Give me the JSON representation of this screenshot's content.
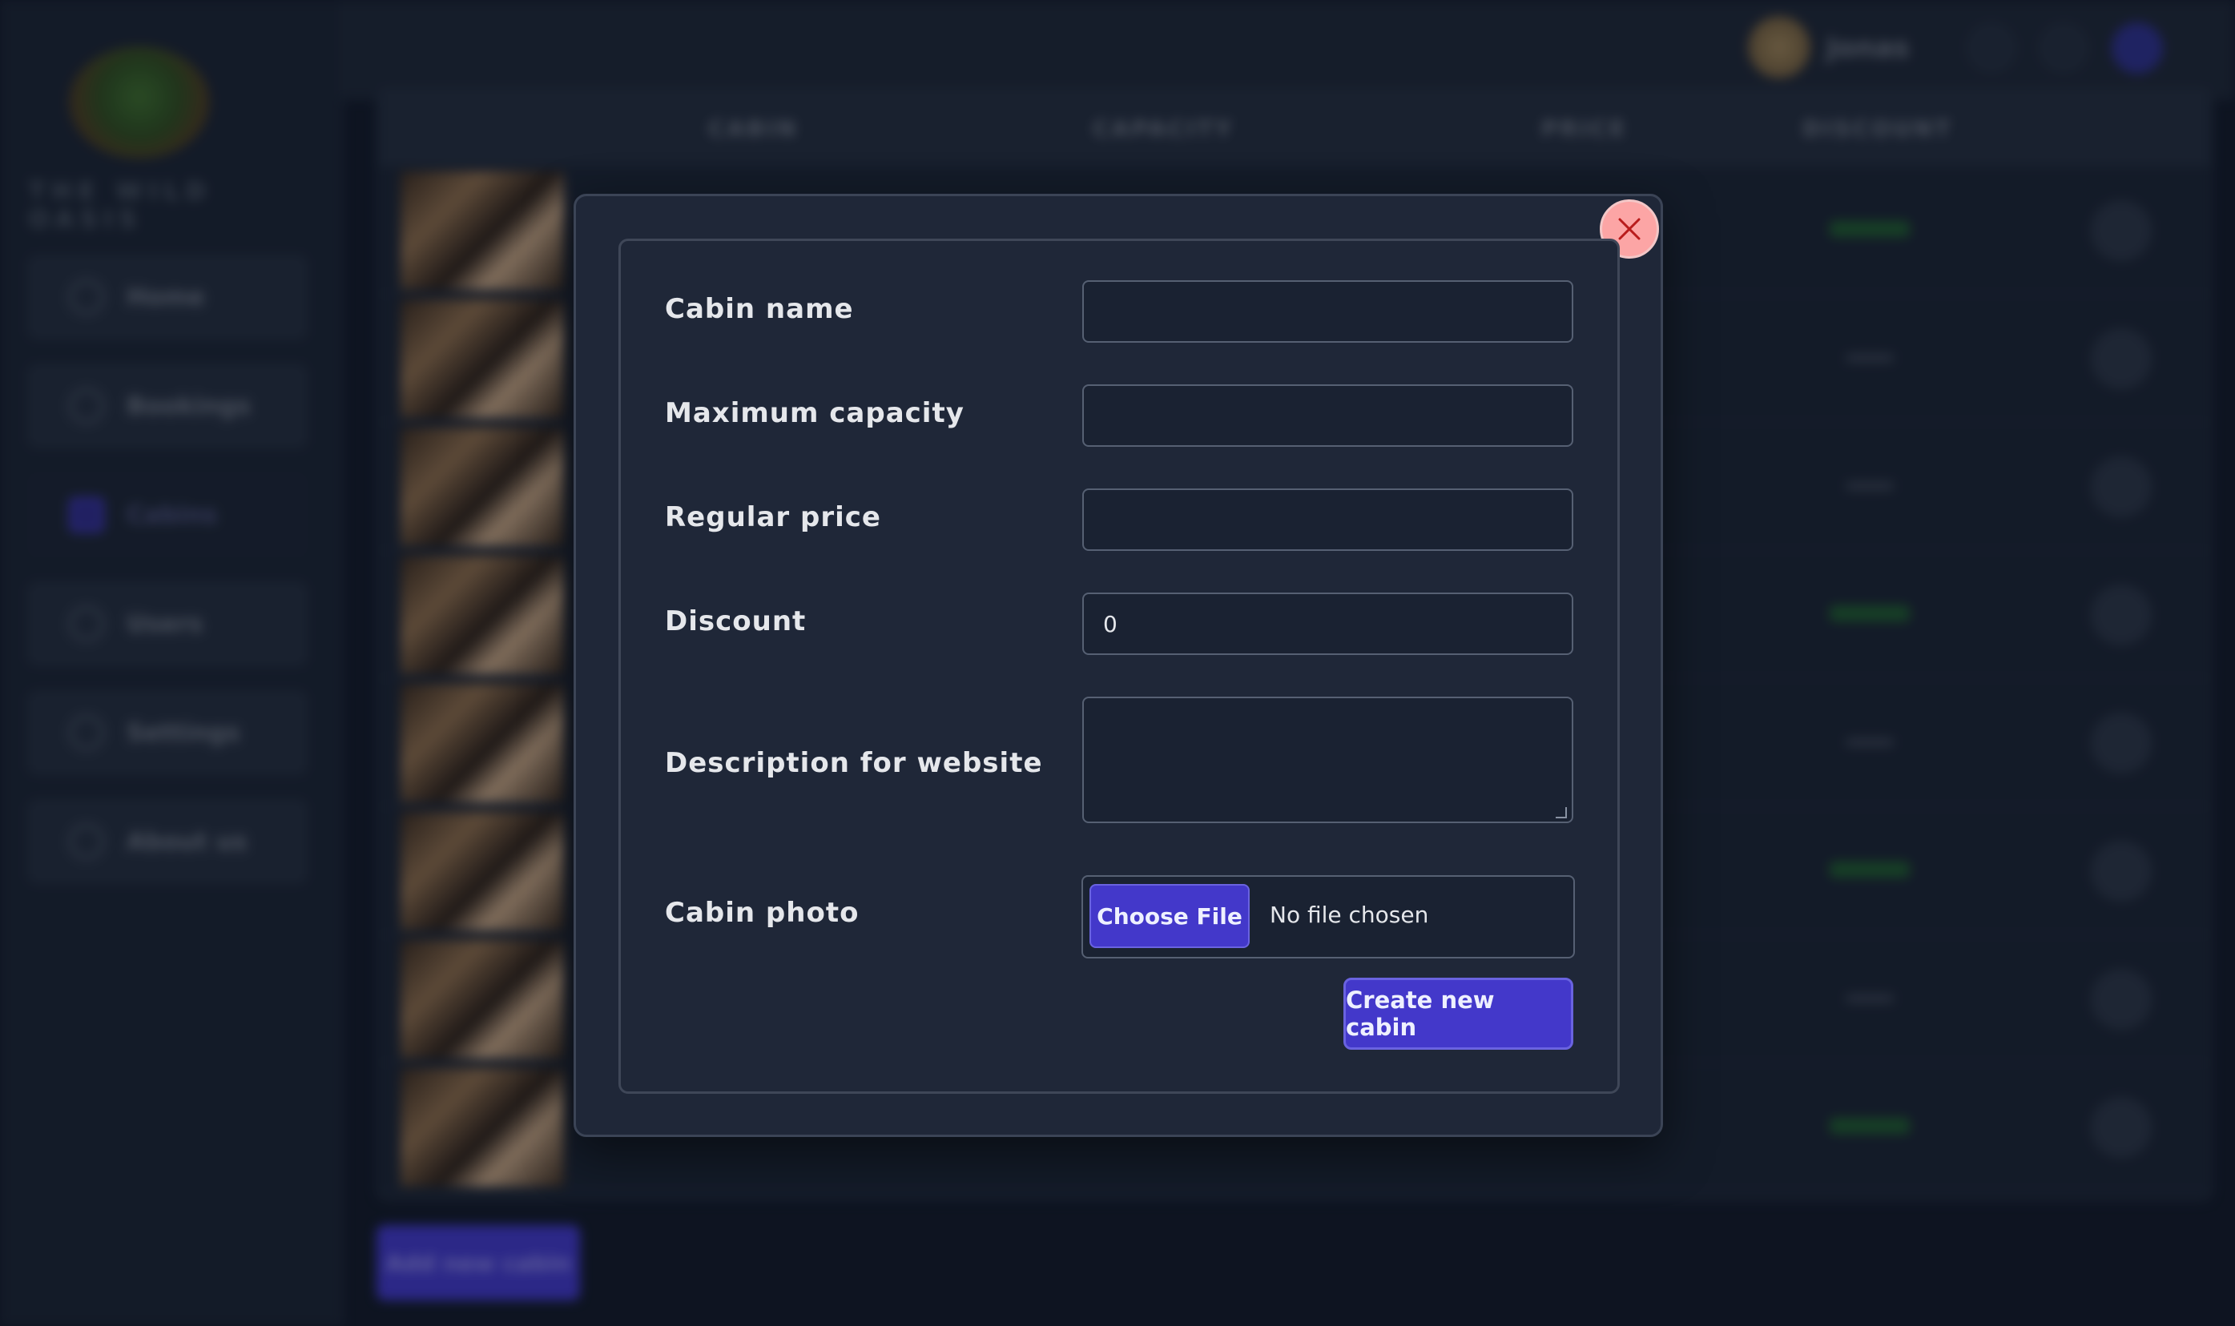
{
  "sidebar": {
    "logo_text": "THE WILD OASIS",
    "items": [
      {
        "label": "Home"
      },
      {
        "label": "Bookings"
      },
      {
        "label": "Cabins"
      },
      {
        "label": "Users"
      },
      {
        "label": "Settings"
      },
      {
        "label": "About us"
      }
    ]
  },
  "header": {
    "user_name": "Jonas"
  },
  "table": {
    "columns": [
      "CABIN",
      "CAPACITY",
      "PRICE",
      "DISCOUNT"
    ],
    "rows": [
      {
        "discount": "green"
      },
      {
        "discount": "none"
      },
      {
        "discount": "none"
      },
      {
        "discount": "green"
      },
      {
        "discount": "none"
      },
      {
        "discount": "green"
      },
      {
        "discount": "none"
      },
      {
        "discount": "green"
      }
    ],
    "add_button": "Add new cabin"
  },
  "modal": {
    "fields": {
      "cabin_name": {
        "label": "Cabin name",
        "value": ""
      },
      "max_capacity": {
        "label": "Maximum capacity",
        "value": ""
      },
      "regular_price": {
        "label": "Regular price",
        "value": ""
      },
      "discount": {
        "label": "Discount",
        "value": "0"
      },
      "description": {
        "label": "Description for website",
        "value": ""
      },
      "photo": {
        "label": "Cabin photo",
        "button": "Choose File",
        "status": "No file chosen"
      }
    },
    "submit_label": "Create new cabin"
  },
  "colors": {
    "accent": "#4338ca",
    "close_button": "#fca5a5",
    "modal_bg": "#1f2738",
    "page_bg": "#111827"
  }
}
